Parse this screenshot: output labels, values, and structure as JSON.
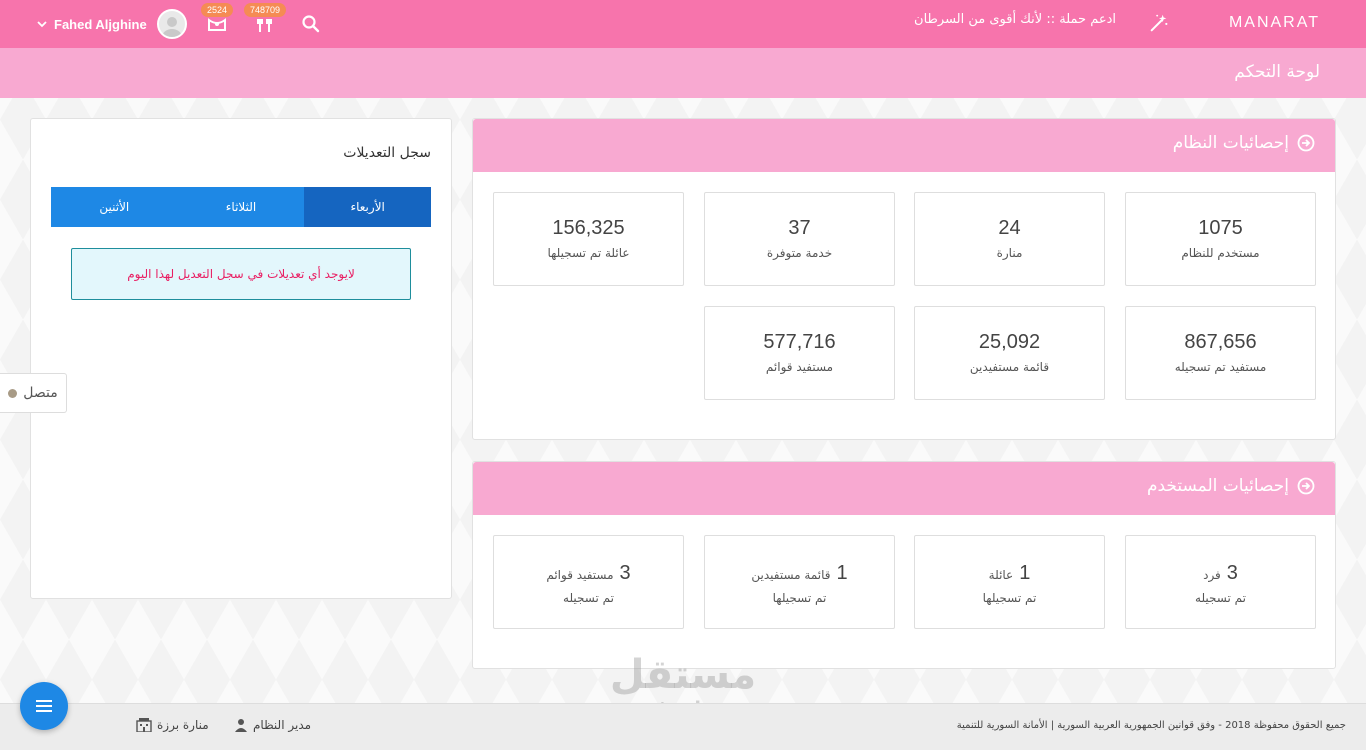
{
  "topbar": {
    "brand": "MANARAT",
    "campaign": "ادعم حملة :: لأنك أقوى من السرطان",
    "user_name": "Fahed Aljghine",
    "badge_messages": "2524",
    "badge_orders": "748709"
  },
  "page": {
    "title": "لوحة التحكم"
  },
  "system_stats": {
    "title": "إحصائيات النظام",
    "items": [
      {
        "value": "1075",
        "label": "مستخدم للنظام"
      },
      {
        "value": "24",
        "label": "منارة"
      },
      {
        "value": "37",
        "label": "خدمة متوفرة"
      },
      {
        "value": "156,325",
        "label": "عائلة تم تسجيلها"
      },
      {
        "value": "867,656",
        "label": "مستفيد تم تسجيله"
      },
      {
        "value": "25,092",
        "label": "قائمة مستفيدين"
      },
      {
        "value": "577,716",
        "label": "مستفيد قوائم"
      }
    ]
  },
  "user_stats": {
    "title": "إحصائيات المستخدم",
    "items": [
      {
        "value": "3",
        "unit": "فرد",
        "label": "تم تسجيله"
      },
      {
        "value": "1",
        "unit": "عائلة",
        "label": "تم تسجيلها"
      },
      {
        "value": "1",
        "unit": "قائمة مستفيدين",
        "label": "تم تسجيلها"
      },
      {
        "value": "3",
        "unit": "مستفيد قوائم",
        "label": "تم تسجيله"
      }
    ]
  },
  "changelog": {
    "title": "سجل التعديلات",
    "tabs": [
      "الأربعاء",
      "الثلاثاء",
      "الأثنين"
    ],
    "empty_message": "لايوجد أي تعديلات في سجل التعديل لهذا اليوم"
  },
  "online": {
    "label": "متصل"
  },
  "footer": {
    "copyright": "جميع الحقوق محفوظة 2018 - وفق قوانين الجمهورية العربية السورية | الأمانة السورية للتنمية",
    "role": "مدير النظام",
    "location": "منارة برزة"
  },
  "watermark": {
    "arabic": "مستقل",
    "latin": "mostaql.com"
  },
  "colors": {
    "topbar": "#f774ac",
    "header": "#f8a9d1",
    "accent": "#1e88e5",
    "badge": "#f58b54",
    "alert_text": "#e91e63"
  }
}
